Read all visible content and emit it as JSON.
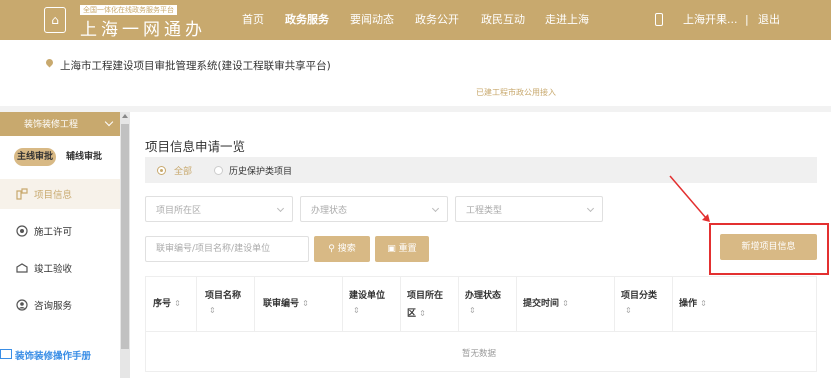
{
  "header": {
    "slogan": "全国一体化在线政务服务平台",
    "brand": "上海一网通办",
    "nav": [
      "首页",
      "政务服务",
      "要闻动态",
      "政务公开",
      "政民互动",
      "走进上海"
    ],
    "active_nav": "政务服务",
    "user": "上海开果...",
    "separator": "|",
    "logout": "退出",
    "colors": {
      "brand": "#c8a96e",
      "accent": "#d8b985",
      "highlight_frame": "#e33030",
      "link_blue": "#3a8ee6"
    }
  },
  "site": {
    "title": "上海市工程建设项目审批管理系统(建设工程联审共享平台)",
    "link": "已建工程市政公用接入"
  },
  "sidebar": {
    "category": "装饰装修工程",
    "tabs": [
      "主线审批",
      "辅线审批"
    ],
    "items": [
      {
        "label": "项目信息",
        "icon": "project-info-icon",
        "active": true
      },
      {
        "label": "施工许可",
        "icon": "permit-icon",
        "active": false
      },
      {
        "label": "竣工验收",
        "icon": "acceptance-icon",
        "active": false
      },
      {
        "label": "咨询服务",
        "icon": "consult-icon",
        "active": false
      }
    ],
    "manual": "装饰装修操作手册"
  },
  "main": {
    "heading": "项目信息申请一览",
    "radios": [
      {
        "label": "全部",
        "checked": true
      },
      {
        "label": "历史保护类项目",
        "checked": false
      }
    ],
    "filters": {
      "district": "项目所在区",
      "status": "办理状态",
      "type": "工程类型"
    },
    "search": {
      "placeholder": "联审编号/项目名称/建设单位",
      "search_btn": "搜索",
      "reset_btn": "重置"
    },
    "new_btn": "新增项目信息",
    "table": {
      "columns": [
        [
          "序号"
        ],
        [
          "项目名称"
        ],
        [
          "联审编号"
        ],
        [
          "建设单位"
        ],
        [
          "项目所在",
          "区"
        ],
        [
          "办理状态"
        ],
        [
          "提交时间"
        ],
        [
          "项目分类"
        ],
        [
          "操作"
        ]
      ],
      "sort_glyph": "⇕",
      "empty": "暂无数据"
    }
  }
}
